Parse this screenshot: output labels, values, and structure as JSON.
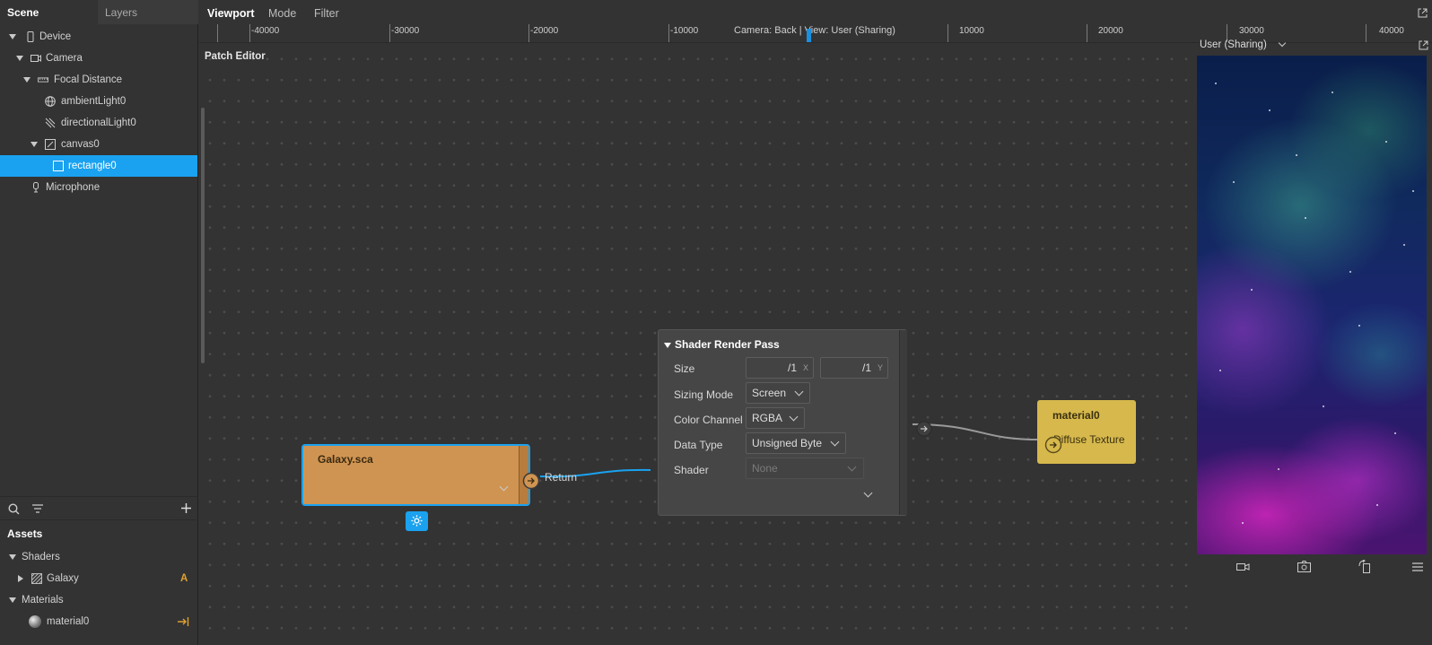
{
  "left_panel": {
    "tabs": [
      {
        "label": "Scene"
      },
      {
        "label": "Layers"
      }
    ],
    "tree": [
      {
        "label": "Device",
        "icon": "device-icon"
      },
      {
        "label": "Camera",
        "icon": "camera-icon"
      },
      {
        "label": "Focal Distance",
        "icon": "ruler-icon"
      },
      {
        "label": "ambientLight0",
        "icon": "globe-icon"
      },
      {
        "label": "directionalLight0",
        "icon": "directional-light-icon"
      },
      {
        "label": "canvas0",
        "icon": "canvas-icon"
      },
      {
        "label": "rectangle0",
        "icon": "rectangle-icon"
      },
      {
        "label": "Microphone",
        "icon": "microphone-icon"
      }
    ],
    "assets": {
      "title": "Assets",
      "groups": [
        {
          "label": "Shaders",
          "items": [
            {
              "label": "Galaxy",
              "badge": "A"
            }
          ]
        },
        {
          "label": "Materials",
          "items": [
            {
              "label": "material0"
            }
          ]
        }
      ]
    }
  },
  "topbar": {
    "items": [
      {
        "label": "Viewport"
      },
      {
        "label": "Mode"
      },
      {
        "label": "Filter"
      }
    ],
    "ruler_labels": [
      "-40000",
      "-30000",
      "-20000",
      "-10000",
      "10000",
      "20000",
      "30000",
      "40000"
    ],
    "camera_label": "Camera: Back | View: User (Sharing)"
  },
  "patch_editor": {
    "title": "Patch Editor",
    "galaxy_node": {
      "title": "Galaxy.sca",
      "output": "Return"
    },
    "shader_render_pass": {
      "title": "Shader Render Pass",
      "rows": [
        {
          "label": "Size",
          "x_value": "/1",
          "x_suffix": "X",
          "y_value": "/1",
          "y_suffix": "Y"
        },
        {
          "label": "Sizing Mode",
          "value": "Screen"
        },
        {
          "label": "Color Channel",
          "value": "RGBA"
        },
        {
          "label": "Data Type",
          "value": "Unsigned Byte"
        },
        {
          "label": "Shader",
          "value": "None"
        }
      ]
    },
    "material_node": {
      "title": "material0",
      "input": "Diffuse Texture"
    }
  },
  "preview": {
    "view_select": "User (Sharing)"
  },
  "colors": {
    "accent": "#1aa2f0",
    "galaxy_node": "#d09452",
    "material_node": "#d6b84c",
    "panel": "#333333"
  }
}
